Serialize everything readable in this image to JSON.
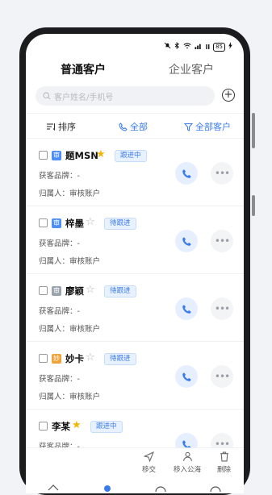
{
  "status_bar": {
    "signal": "ll",
    "battery": "85"
  },
  "tabs": [
    {
      "label": "普通客户",
      "active": true
    },
    {
      "label": "企业客户",
      "active": false
    }
  ],
  "search": {
    "placeholder": "客户姓名/手机号"
  },
  "filters": {
    "sort_label": "排序",
    "call_filter_label": "全部",
    "customer_filter_label": "全部客户"
  },
  "customers": [
    {
      "avatar_char": "审",
      "avatar_color": "#4d8ef7",
      "name": "题MSN",
      "starred": true,
      "badge": "跟进中",
      "brand_label": "获客品牌：",
      "brand_value": "-",
      "owner_label": "归属人：",
      "owner_value": "审核账户"
    },
    {
      "avatar_char": "审",
      "avatar_color": "#4d8ef7",
      "name": "梓墨",
      "starred": false,
      "badge": "待跟进",
      "brand_label": "获客品牌：",
      "brand_value": "-",
      "owner_label": "归属人：",
      "owner_value": "审核账户"
    },
    {
      "avatar_char": "审",
      "avatar_color": "#9aa3ae",
      "name": "廖颖",
      "starred": false,
      "badge": "待跟进",
      "brand_label": "获客品牌：",
      "brand_value": "-",
      "owner_label": "归属人：",
      "owner_value": "审核账户"
    },
    {
      "avatar_char": "妙",
      "avatar_color": "#f0a33a",
      "name": "妙卡",
      "starred": false,
      "badge": "待跟进",
      "brand_label": "获客品牌：",
      "brand_value": "-",
      "owner_label": "归属人：",
      "owner_value": "审核账户"
    },
    {
      "avatar_char": "",
      "avatar_color": "",
      "name": "李某",
      "starred": true,
      "badge": "跟进中",
      "brand_label": "获客品牌：",
      "brand_value": "-",
      "owner_label": "",
      "owner_value": ""
    }
  ],
  "actions": {
    "transfer": "移交",
    "move_public": "移入公海",
    "delete": "删除"
  },
  "colors": {
    "accent": "#3a7af0",
    "star": "#f5b400"
  }
}
